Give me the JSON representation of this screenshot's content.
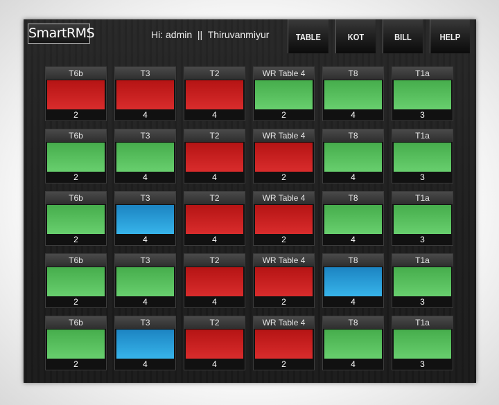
{
  "app": {
    "logo": "SmartRMS"
  },
  "header": {
    "greeting": "Hi: admin  ||  Thiruvanmiyur"
  },
  "nav": [
    {
      "label": "TABLE",
      "name": "nav-table-button"
    },
    {
      "label": "KOT",
      "name": "nav-kot-button"
    },
    {
      "label": "BILL",
      "name": "nav-bill-button"
    },
    {
      "label": "HELP",
      "name": "nav-help-button"
    }
  ],
  "colors": {
    "red": "#cc2222",
    "green": "#55c060",
    "blue": "#2a9bd6"
  },
  "tables": [
    [
      {
        "name": "T6b",
        "seats": "2",
        "status": "red"
      },
      {
        "name": "T3",
        "seats": "4",
        "status": "red"
      },
      {
        "name": "T2",
        "seats": "4",
        "status": "red"
      },
      {
        "name": "WR Table 4",
        "seats": "2",
        "status": "green"
      },
      {
        "name": "T8",
        "seats": "4",
        "status": "green"
      },
      {
        "name": "T1a",
        "seats": "3",
        "status": "green"
      }
    ],
    [
      {
        "name": "T6b",
        "seats": "2",
        "status": "green"
      },
      {
        "name": "T3",
        "seats": "4",
        "status": "green"
      },
      {
        "name": "T2",
        "seats": "4",
        "status": "red"
      },
      {
        "name": "WR Table 4",
        "seats": "2",
        "status": "red"
      },
      {
        "name": "T8",
        "seats": "4",
        "status": "green"
      },
      {
        "name": "T1a",
        "seats": "3",
        "status": "green"
      }
    ],
    [
      {
        "name": "T6b",
        "seats": "2",
        "status": "green"
      },
      {
        "name": "T3",
        "seats": "4",
        "status": "blue"
      },
      {
        "name": "T2",
        "seats": "4",
        "status": "red"
      },
      {
        "name": "WR Table 4",
        "seats": "2",
        "status": "red"
      },
      {
        "name": "T8",
        "seats": "4",
        "status": "green"
      },
      {
        "name": "T1a",
        "seats": "3",
        "status": "green"
      }
    ],
    [
      {
        "name": "T6b",
        "seats": "2",
        "status": "green"
      },
      {
        "name": "T3",
        "seats": "4",
        "status": "green"
      },
      {
        "name": "T2",
        "seats": "4",
        "status": "red"
      },
      {
        "name": "WR Table 4",
        "seats": "2",
        "status": "red"
      },
      {
        "name": "T8",
        "seats": "4",
        "status": "blue"
      },
      {
        "name": "T1a",
        "seats": "3",
        "status": "green"
      }
    ],
    [
      {
        "name": "T6b",
        "seats": "2",
        "status": "green"
      },
      {
        "name": "T3",
        "seats": "4",
        "status": "blue"
      },
      {
        "name": "T2",
        "seats": "4",
        "status": "red"
      },
      {
        "name": "WR Table 4",
        "seats": "2",
        "status": "red"
      },
      {
        "name": "T8",
        "seats": "4",
        "status": "green"
      },
      {
        "name": "T1a",
        "seats": "3",
        "status": "green"
      }
    ]
  ]
}
